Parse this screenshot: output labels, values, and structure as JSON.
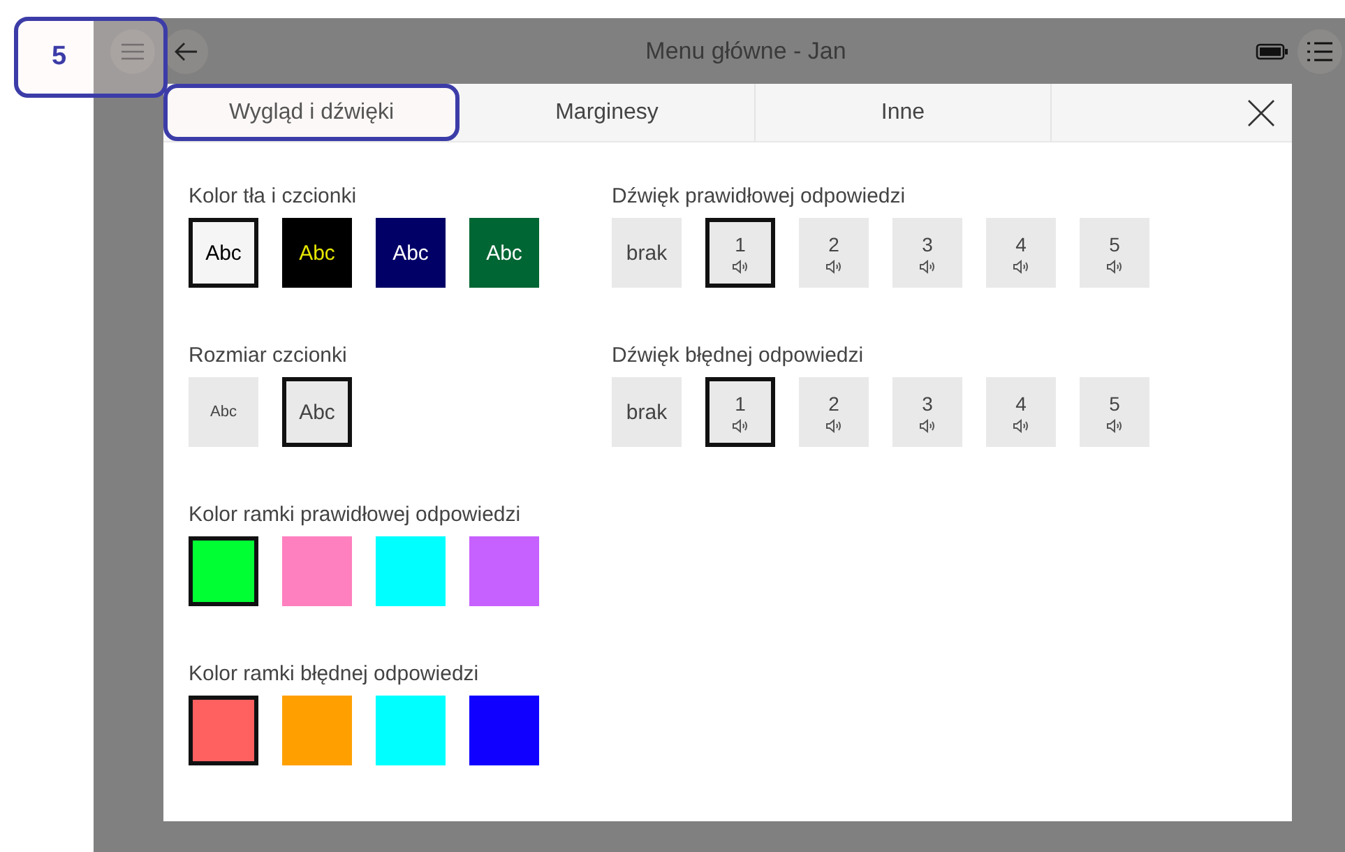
{
  "callout": {
    "label": "5"
  },
  "topbar": {
    "title": "Menu główne - Jan"
  },
  "tabs": [
    {
      "label": "Wygląd i dźwięki",
      "selected": true,
      "highlighted": true
    },
    {
      "label": "Marginesy",
      "selected": false,
      "highlighted": false
    },
    {
      "label": "Inne",
      "selected": false,
      "highlighted": false
    }
  ],
  "left_column": [
    {
      "title": "Kolor tła i czcionki",
      "kind": "text",
      "options": [
        {
          "label": "Abc",
          "color": "#f5f5f5",
          "kind": "dark",
          "selected": true
        },
        {
          "label": "Abc",
          "color": "#000000",
          "kind": "yellow",
          "selected": false
        },
        {
          "label": "Abc",
          "color": "#000066",
          "kind": "light",
          "selected": false
        },
        {
          "label": "Abc",
          "color": "#006633",
          "kind": "light",
          "selected": false
        }
      ]
    },
    {
      "title": "Rozmiar czcionki",
      "kind": "text",
      "options": [
        {
          "label": "Abc",
          "color": "#e9e9e9",
          "kind": "small",
          "selected": false
        },
        {
          "label": "Abc",
          "color": "#e9e9e9",
          "kind": "large",
          "selected": true
        }
      ]
    },
    {
      "title": "Kolor ramki prawidłowej odpowiedzi",
      "kind": "color",
      "options": [
        {
          "color": "#00ff33",
          "selected": true
        },
        {
          "color": "#ff80bf",
          "selected": false
        },
        {
          "color": "#00ffff",
          "selected": false
        },
        {
          "color": "#c660ff",
          "selected": false
        }
      ]
    },
    {
      "title": "Kolor ramki błędnej odpowiedzi",
      "kind": "color",
      "options": [
        {
          "color": "#ff6060",
          "selected": true
        },
        {
          "color": "#ffa000",
          "selected": false
        },
        {
          "color": "#00ffff",
          "selected": false
        },
        {
          "color": "#1000ff",
          "selected": false
        }
      ]
    }
  ],
  "right_column": [
    {
      "title": "Dźwięk prawidłowej odpowiedzi",
      "kind": "sound",
      "options": [
        {
          "label": "brak",
          "kind": "none",
          "selected": false
        },
        {
          "label": "1",
          "kind": "sound",
          "selected": true
        },
        {
          "label": "2",
          "kind": "sound",
          "selected": false
        },
        {
          "label": "3",
          "kind": "sound",
          "selected": false
        },
        {
          "label": "4",
          "kind": "sound",
          "selected": false
        },
        {
          "label": "5",
          "kind": "sound",
          "selected": false
        }
      ]
    },
    {
      "title": "Dźwięk błędnej odpowiedzi",
      "kind": "sound",
      "options": [
        {
          "label": "brak",
          "kind": "none",
          "selected": false
        },
        {
          "label": "1",
          "kind": "sound",
          "selected": true
        },
        {
          "label": "2",
          "kind": "sound",
          "selected": false
        },
        {
          "label": "3",
          "kind": "sound",
          "selected": false
        },
        {
          "label": "4",
          "kind": "sound",
          "selected": false
        },
        {
          "label": "5",
          "kind": "sound",
          "selected": false
        }
      ]
    }
  ]
}
